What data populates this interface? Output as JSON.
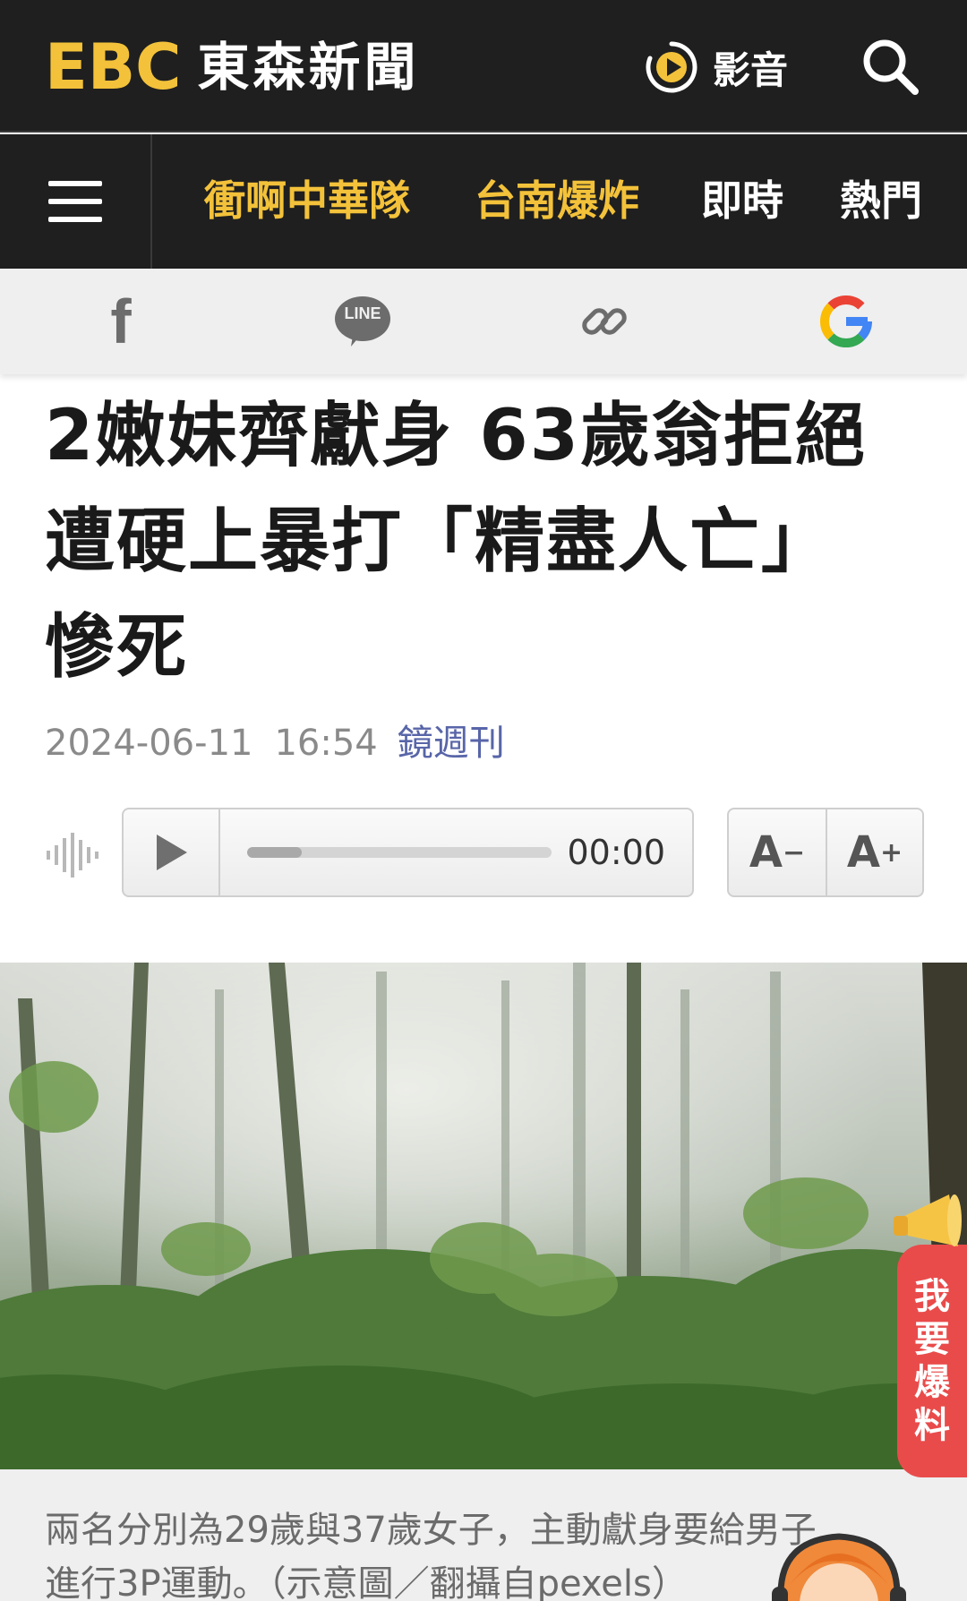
{
  "header": {
    "logo_ebc": "EBC",
    "logo_name": "東森新聞",
    "media_label": "影音"
  },
  "nav": {
    "items": [
      {
        "label": "衝啊中華隊",
        "highlight": true
      },
      {
        "label": "台南爆炸",
        "highlight": true
      },
      {
        "label": "即時",
        "highlight": false
      },
      {
        "label": "熱門",
        "highlight": false
      }
    ]
  },
  "share": {
    "facebook": "f",
    "line": "LINE",
    "link_icon": "link-icon",
    "google": "G"
  },
  "article": {
    "title_line1": "2嫩妹齊獻身 63歲翁拒絕",
    "title_line2": "遭硬上暴打「精盡人亡」",
    "title_line3": "慘死",
    "date": "2024-06-11",
    "time": "16:54",
    "source": "鏡週刊"
  },
  "audio": {
    "current_time": "00:00",
    "progress": 0.18
  },
  "font_controls": {
    "decrease": "A",
    "decrease_sign": "−",
    "increase": "A",
    "increase_sign": "+"
  },
  "caption": {
    "line1": "兩名分別為29歲與37歲女子，主動獻身要給男子",
    "line2": "進行3P運動。（示意圖／翻攝自pexels）"
  },
  "tip_widget": {
    "chars": [
      "我",
      "要",
      "爆",
      "料"
    ]
  },
  "colors": {
    "header_bg": "#1f1f1f",
    "brand_yellow": "#f3c23a",
    "source_link": "#5865a8",
    "tip_red": "#e94b4b"
  }
}
